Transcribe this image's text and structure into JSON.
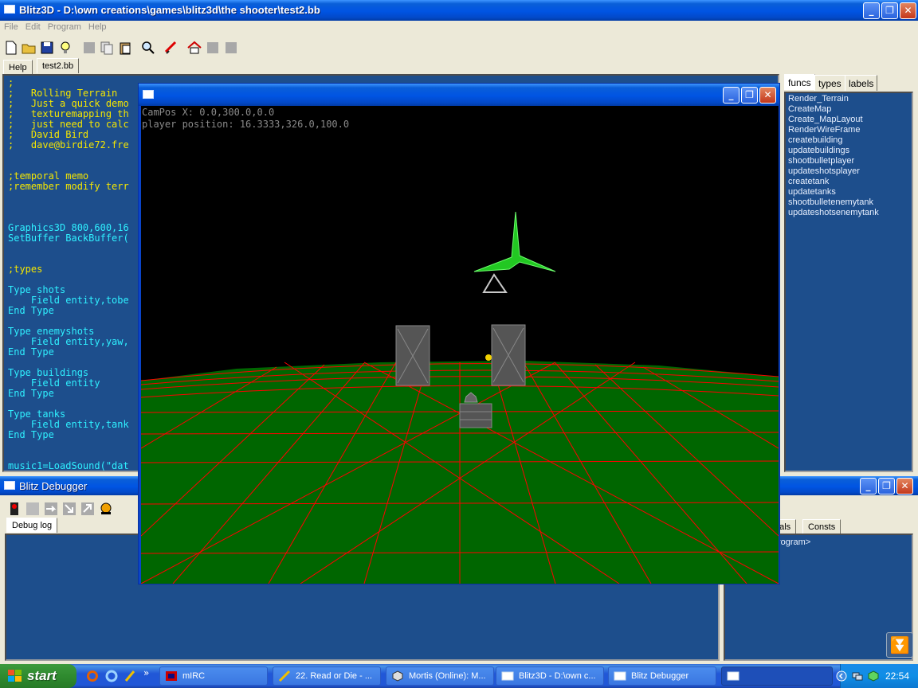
{
  "ide": {
    "title": "Blitz3D - D:\\own creations\\games\\blitz3d\\the shooter\\test2.bb",
    "menu": [
      "File",
      "Edit",
      "Program",
      "Help"
    ],
    "tabs": [
      "Help",
      "test2.bb"
    ],
    "editor_lines": [
      ";",
      ";   Rolling Terrain",
      ";   Just a quick demo",
      ";   texturemapping th",
      ";   just need to calc",
      ";   David Bird",
      ";   dave@birdie72.fre",
      "",
      "",
      ";temporal memo",
      ";remember modify terr",
      "",
      "",
      "",
      "Graphics3D 800,600,16",
      "SetBuffer BackBuffer(",
      "",
      "",
      ";types",
      "",
      "Type shots",
      "    Field entity,tobe",
      "End Type",
      "",
      "Type enemyshots",
      "    Field entity,yaw,",
      "End Type",
      "",
      "Type buildings",
      "    Field entity",
      "End Type",
      "",
      "Type tanks",
      "    Field entity,tank",
      "End Type",
      "",
      "",
      "music1=LoadSound(\"dat"
    ],
    "side_tabs": [
      "funcs",
      "types",
      "labels"
    ],
    "functions": [
      "Render_Terrain",
      "CreateMap",
      "Create_MapLayout",
      "RenderWireFrame",
      "createbuilding",
      "updatebuildings",
      "shootbulletplayer",
      "updateshotsplayer",
      "createtank",
      "updatetanks",
      "shootbulletenemytank",
      "updateshotsenemytank"
    ]
  },
  "debugger": {
    "title": "Blitz Debugger",
    "tab": "Debug log",
    "right_tabs": [
      "bals",
      "Consts"
    ],
    "right_text": "rogram>"
  },
  "game": {
    "title": "",
    "hud_line1": "CamPos X: 0.0,300.0,0.0",
    "hud_line2": "player position: 16.3333,326.0,100.0"
  },
  "taskbar": {
    "start_label": "start",
    "buttons": [
      {
        "label": "mIRC",
        "icon": "mirc-icon"
      },
      {
        "label": "22. Read or Die - ...",
        "icon": "winamp-icon"
      },
      {
        "label": "Mortis (Online): M...",
        "icon": "messenger-icon"
      },
      {
        "label": "Blitz3D - D:\\own c...",
        "icon": "window-icon"
      },
      {
        "label": "Blitz Debugger",
        "icon": "window-icon"
      },
      {
        "label": "",
        "icon": "window-icon"
      }
    ],
    "clock": "22:54",
    "quicklaunch_more": "»"
  },
  "colors": {
    "editor_bg": "#1d4e8c",
    "comment": "#f5e600",
    "keyword": "#2ff0ff",
    "grid_line": "#ff0000",
    "ground": "#006600",
    "xp_blue": "#0054e3"
  }
}
